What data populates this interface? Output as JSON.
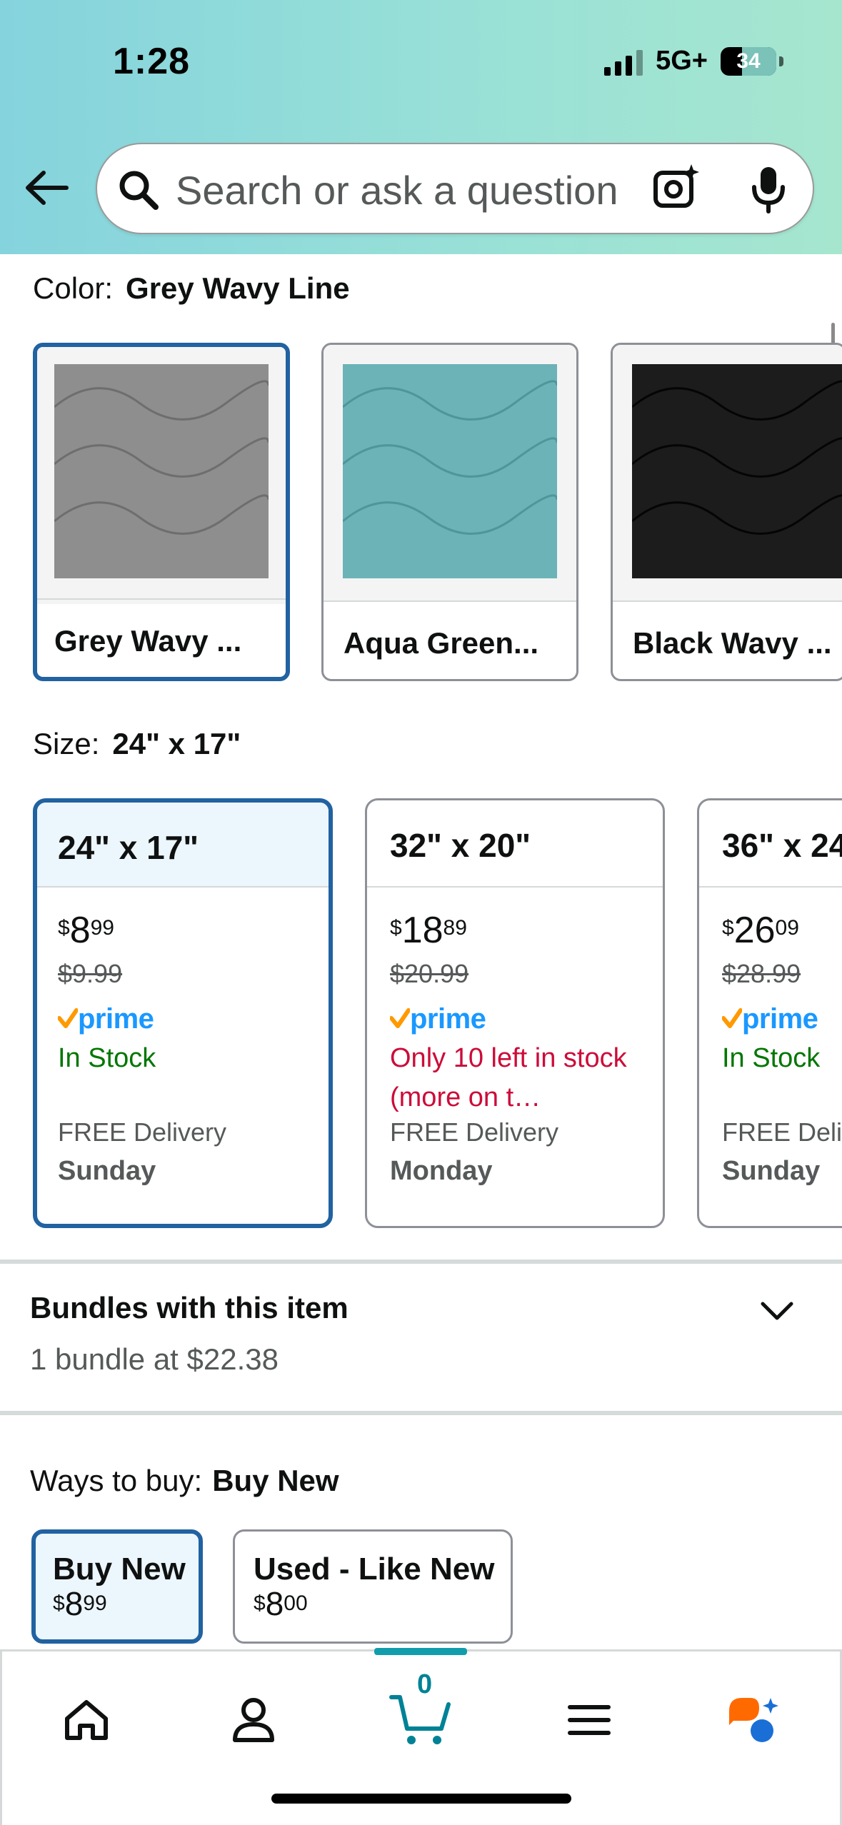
{
  "status_bar": {
    "time": "1:28",
    "network": "5G+",
    "battery": "34"
  },
  "search": {
    "placeholder": "Search or ask a question"
  },
  "color": {
    "label": "Color:",
    "selected": "Grey Wavy Line",
    "options": [
      {
        "label": "Grey Wavy ...",
        "swatch_color": "#8e8e8e",
        "line_color": "#6e6e6e"
      },
      {
        "label": "Aqua Green...",
        "swatch_color": "#6bb3b7",
        "line_color": "#4f9599"
      },
      {
        "label": "Black Wavy ...",
        "swatch_color": "#1c1c1c",
        "line_color": "#0a0a0a"
      }
    ]
  },
  "size": {
    "label": "Size:",
    "selected": "24\" x 17\"",
    "options": [
      {
        "name": "24\" x 17\"",
        "price_symbol": "$",
        "price_whole": "8",
        "price_fraction": "99",
        "was_price": "$9.99",
        "prime": "prime",
        "stock": "In Stock",
        "delivery": "FREE Delivery",
        "day": "Sunday"
      },
      {
        "name": "32\" x 20\"",
        "price_symbol": "$",
        "price_whole": "18",
        "price_fraction": "89",
        "was_price": "$20.99",
        "prime": "prime",
        "stock": "Only 10 left in stock (more on t…",
        "delivery": "FREE Delivery",
        "day": "Monday"
      },
      {
        "name": "36\" x 24",
        "price_symbol": "$",
        "price_whole": "26",
        "price_fraction": "09",
        "was_price": "$28.99",
        "prime": "prime",
        "stock": "In Stock",
        "delivery": "FREE Deli",
        "day": "Sunday"
      }
    ]
  },
  "bundles": {
    "title": "Bundles with this item",
    "subtitle": "1 bundle at $22.38"
  },
  "ways_to_buy": {
    "label": "Ways to buy:",
    "selected": "Buy New",
    "options": [
      {
        "label": "Buy New",
        "price_symbol": "$",
        "price_whole": "8",
        "price_fraction": "99"
      },
      {
        "label": "Used - Like New",
        "price_symbol": "$",
        "price_whole": "8",
        "price_fraction": "00"
      }
    ]
  },
  "tabbar": {
    "cart_count": "0",
    "items": [
      "home-icon",
      "account-icon",
      "cart-icon",
      "menu-icon",
      "rufus-icon"
    ]
  },
  "colors": {
    "selection_border": "#2162a1",
    "prime_blue": "#1a98ff",
    "in_stock": "#007600",
    "low_stock": "#cc0c39",
    "cart_accent": "#008296"
  }
}
